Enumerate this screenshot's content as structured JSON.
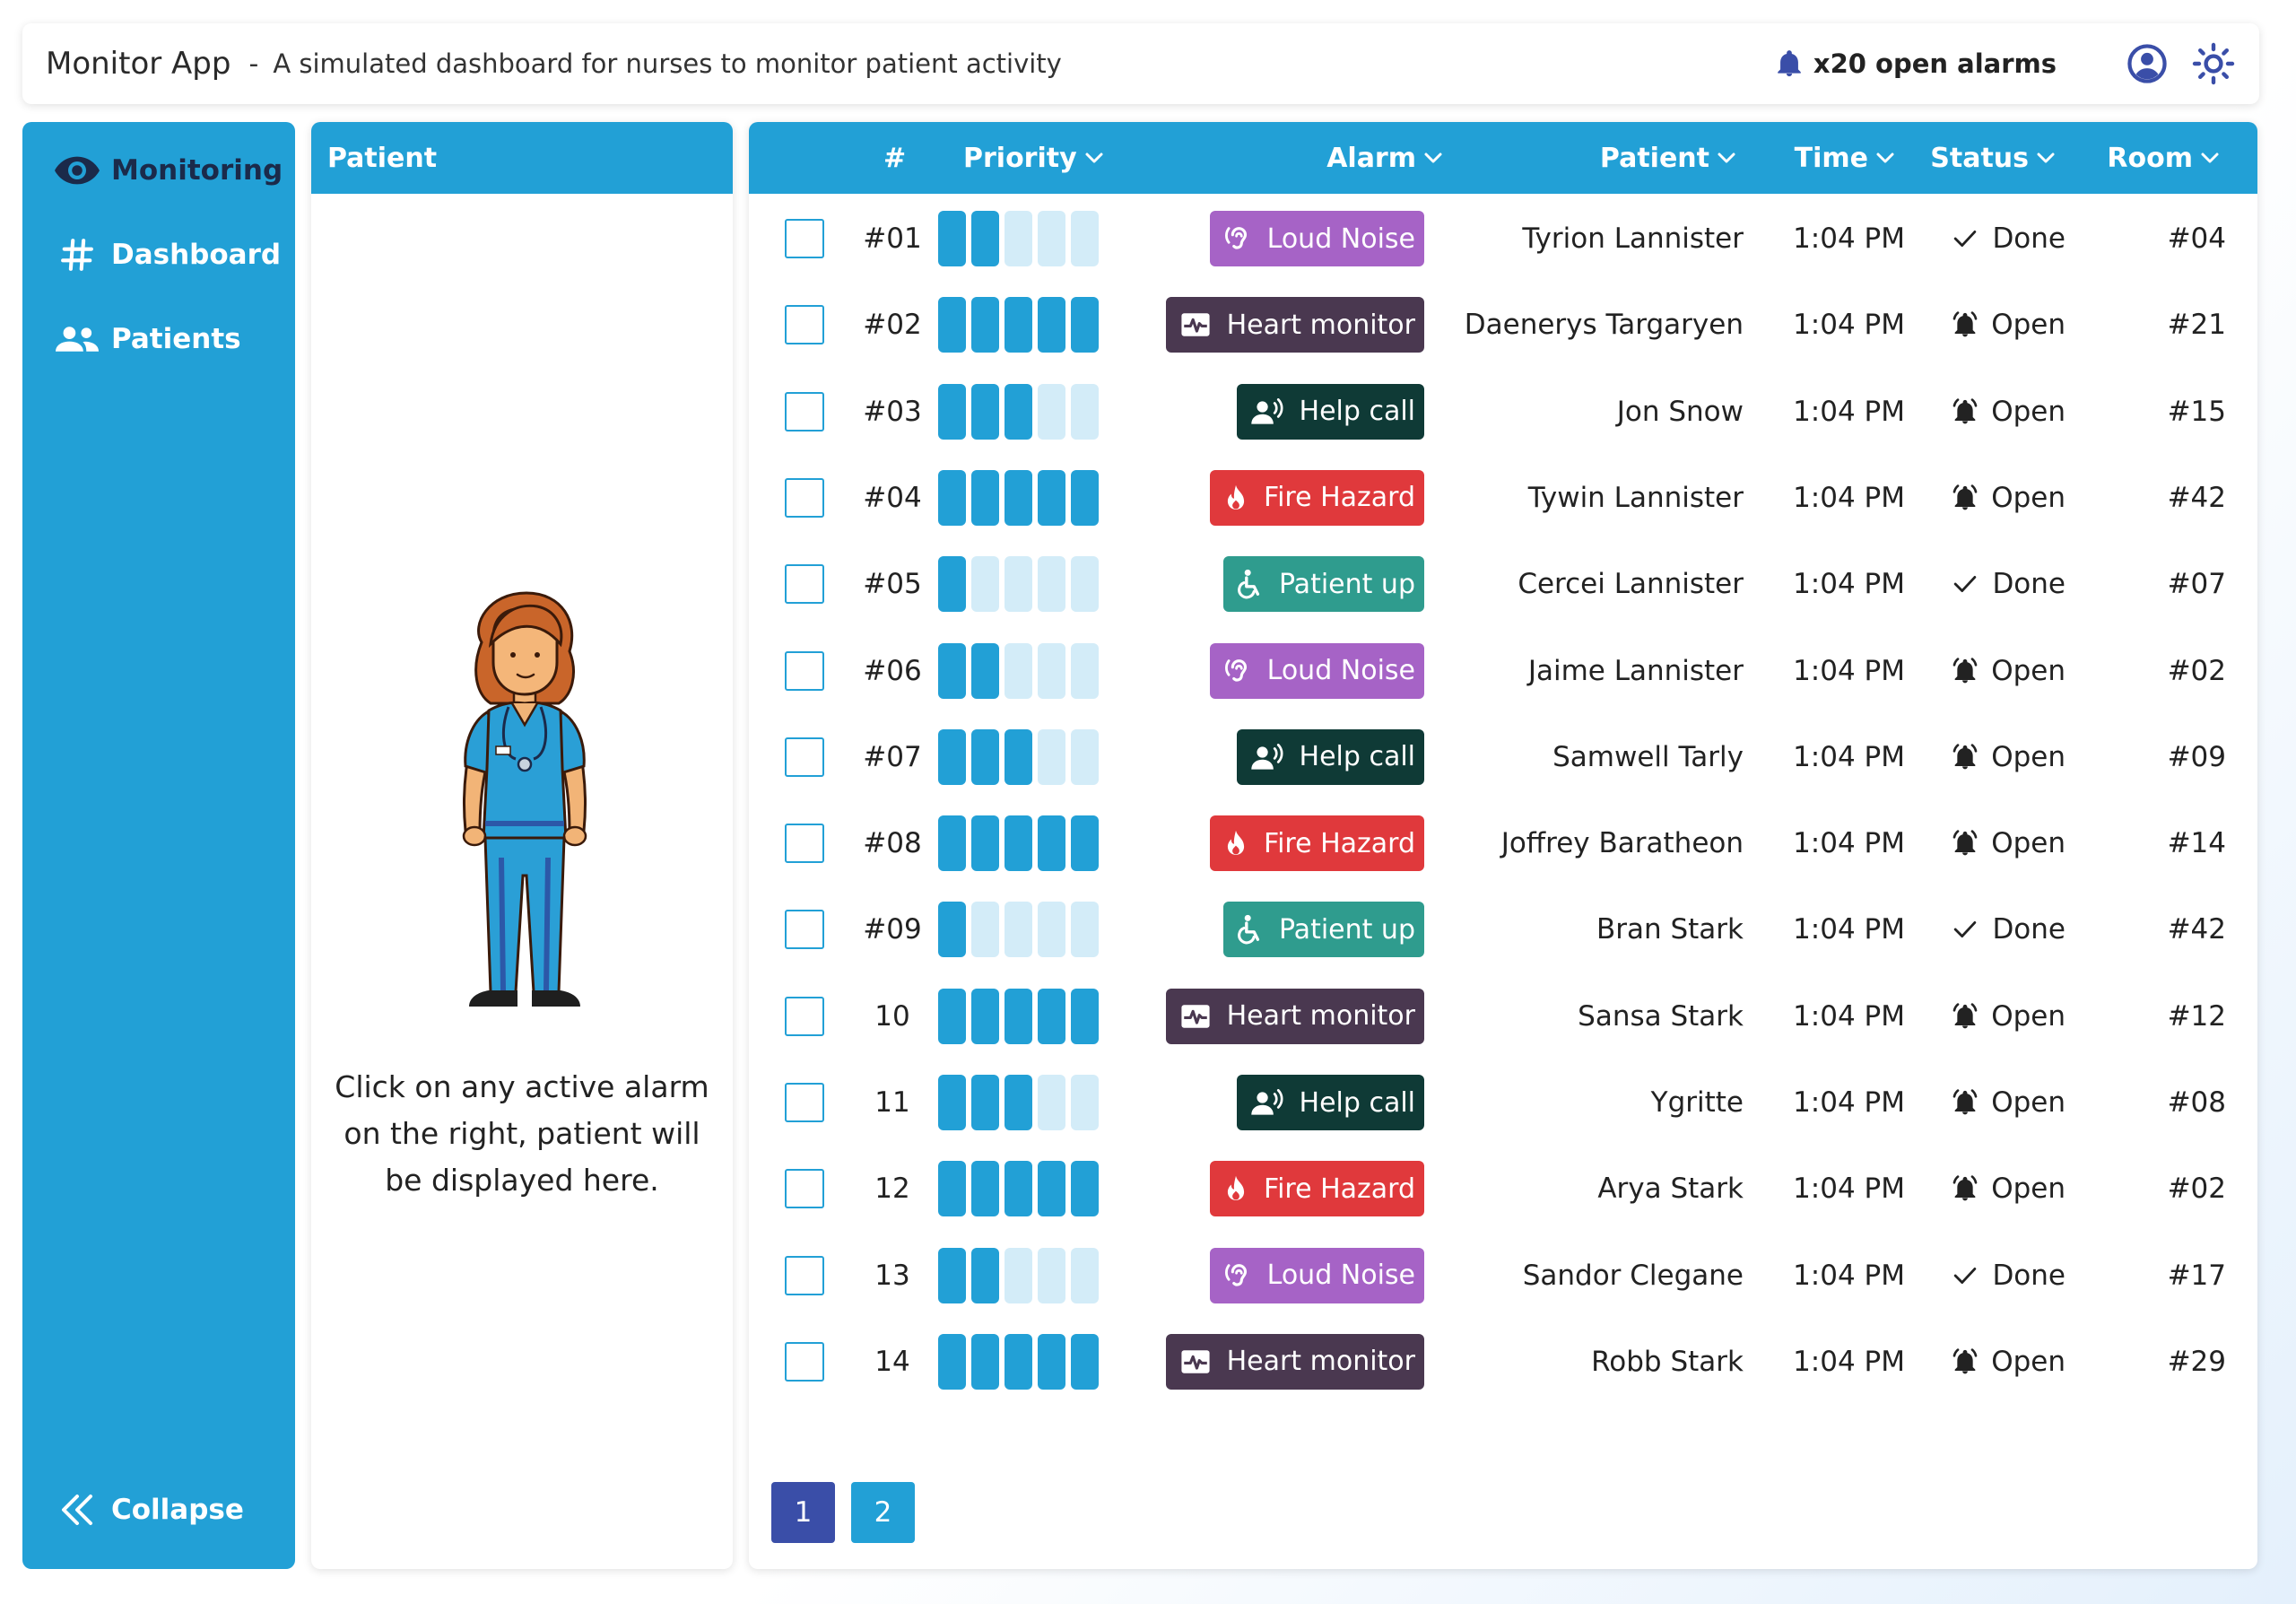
{
  "header": {
    "app_name": "Monitor App",
    "separator": "-",
    "subtitle": "A simulated dashboard for nurses to monitor patient activity",
    "alarm_summary": "x20 open alarms",
    "icons": [
      "bell-icon",
      "user-account-icon",
      "theme-sun-icon"
    ]
  },
  "sidebar": {
    "items": [
      {
        "label": "Monitoring",
        "icon": "eye-icon",
        "active": true
      },
      {
        "label": "Dashboard",
        "icon": "hash-icon",
        "active": false
      },
      {
        "label": "Patients",
        "icon": "people-icon",
        "active": false
      }
    ],
    "collapse_label": "Collapse"
  },
  "patient_panel": {
    "title": "Patient",
    "hint": "Click on any active alarm on the right, patient will be displayed here."
  },
  "table": {
    "columns": {
      "num": "#",
      "priority": "Priority",
      "alarm": "Alarm",
      "patient": "Patient",
      "time": "Time",
      "status": "Status",
      "room": "Room"
    },
    "rows": [
      {
        "num": "#01",
        "priority": 2,
        "alarm": "Loud Noise",
        "alarm_type": "loud",
        "patient": "Tyrion Lannister",
        "time": "1:04 PM",
        "status": "Done",
        "room": "#04"
      },
      {
        "num": "#02",
        "priority": 5,
        "alarm": "Heart monitor",
        "alarm_type": "heart",
        "patient": "Daenerys Targaryen",
        "time": "1:04 PM",
        "status": "Open",
        "room": "#21"
      },
      {
        "num": "#03",
        "priority": 3,
        "alarm": "Help call",
        "alarm_type": "help",
        "patient": "Jon Snow",
        "time": "1:04 PM",
        "status": "Open",
        "room": "#15"
      },
      {
        "num": "#04",
        "priority": 5,
        "alarm": "Fire Hazard",
        "alarm_type": "fire",
        "patient": "Tywin Lannister",
        "time": "1:04 PM",
        "status": "Open",
        "room": "#42"
      },
      {
        "num": "#05",
        "priority": 1,
        "alarm": "Patient up",
        "alarm_type": "up",
        "patient": "Cercei Lannister",
        "time": "1:04 PM",
        "status": "Done",
        "room": "#07"
      },
      {
        "num": "#06",
        "priority": 2,
        "alarm": "Loud Noise",
        "alarm_type": "loud",
        "patient": "Jaime Lannister",
        "time": "1:04 PM",
        "status": "Open",
        "room": "#02"
      },
      {
        "num": "#07",
        "priority": 3,
        "alarm": "Help call",
        "alarm_type": "help",
        "patient": "Samwell Tarly",
        "time": "1:04 PM",
        "status": "Open",
        "room": "#09"
      },
      {
        "num": "#08",
        "priority": 5,
        "alarm": "Fire Hazard",
        "alarm_type": "fire",
        "patient": "Joffrey Baratheon",
        "time": "1:04 PM",
        "status": "Open",
        "room": "#14"
      },
      {
        "num": "#09",
        "priority": 1,
        "alarm": "Patient up",
        "alarm_type": "up",
        "patient": "Bran Stark",
        "time": "1:04 PM",
        "status": "Done",
        "room": "#42"
      },
      {
        "num": "10",
        "priority": 5,
        "alarm": "Heart monitor",
        "alarm_type": "heart",
        "patient": "Sansa Stark",
        "time": "1:04 PM",
        "status": "Open",
        "room": "#12"
      },
      {
        "num": "11",
        "priority": 3,
        "alarm": "Help call",
        "alarm_type": "help",
        "patient": "Ygritte",
        "time": "1:04 PM",
        "status": "Open",
        "room": "#08"
      },
      {
        "num": "12",
        "priority": 5,
        "alarm": "Fire Hazard",
        "alarm_type": "fire",
        "patient": "Arya Stark",
        "time": "1:04 PM",
        "status": "Open",
        "room": "#02"
      },
      {
        "num": "13",
        "priority": 2,
        "alarm": "Loud Noise",
        "alarm_type": "loud",
        "patient": "Sandor Clegane",
        "time": "1:04 PM",
        "status": "Done",
        "room": "#17"
      },
      {
        "num": "14",
        "priority": 5,
        "alarm": "Heart monitor",
        "alarm_type": "heart",
        "patient": "Robb Stark",
        "time": "1:04 PM",
        "status": "Open",
        "room": "#29"
      }
    ],
    "max_priority": 5
  },
  "pagination": {
    "pages": [
      "1",
      "2"
    ],
    "current": "1"
  },
  "colors": {
    "primary": "#22a0d6",
    "priority_off": "#d3ecf8",
    "active_nav": "#1b2a4a",
    "page_active": "#3a4ea8",
    "loud": "#a663c6",
    "heart": "#4a3850",
    "help": "#0f3a36",
    "fire": "#e0393c",
    "up": "#2f9c8e"
  }
}
